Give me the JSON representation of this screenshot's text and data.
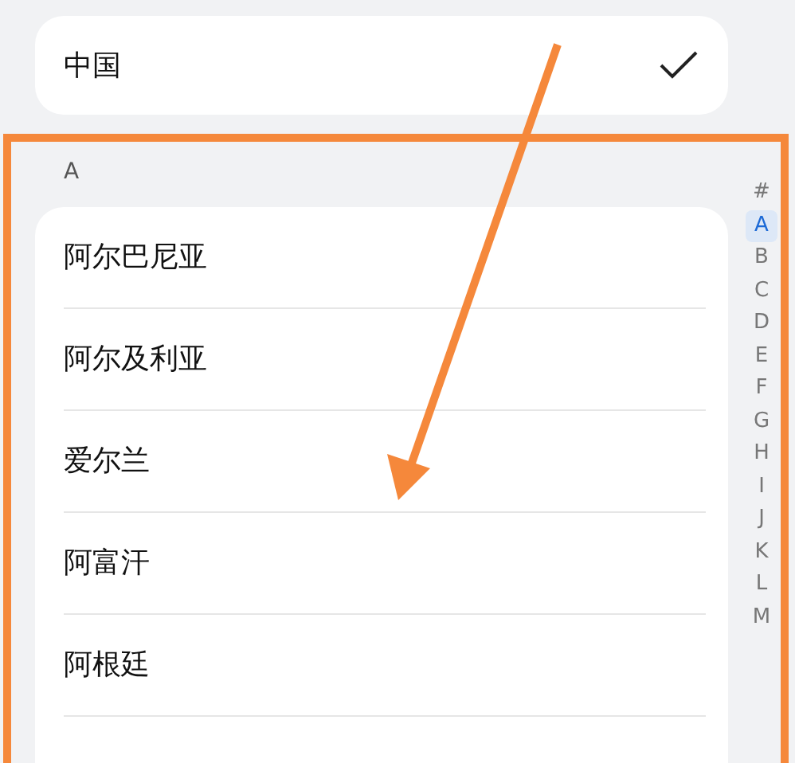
{
  "current": {
    "name": "中国",
    "checked": true
  },
  "sections": [
    {
      "header": "A",
      "countries": [
        {
          "name": "阿尔巴尼亚"
        },
        {
          "name": "阿尔及利亚"
        },
        {
          "name": "爱尔兰"
        },
        {
          "name": "阿富汗"
        },
        {
          "name": "阿根廷"
        }
      ]
    }
  ],
  "index": [
    {
      "label": "#",
      "selected": false
    },
    {
      "label": "A",
      "selected": true
    },
    {
      "label": "B",
      "selected": false
    },
    {
      "label": "C",
      "selected": false
    },
    {
      "label": "D",
      "selected": false
    },
    {
      "label": "E",
      "selected": false
    },
    {
      "label": "F",
      "selected": false
    },
    {
      "label": "G",
      "selected": false
    },
    {
      "label": "H",
      "selected": false
    },
    {
      "label": "I",
      "selected": false
    },
    {
      "label": "J",
      "selected": false
    },
    {
      "label": "K",
      "selected": false
    },
    {
      "label": "L",
      "selected": false
    },
    {
      "label": "M",
      "selected": false
    }
  ]
}
